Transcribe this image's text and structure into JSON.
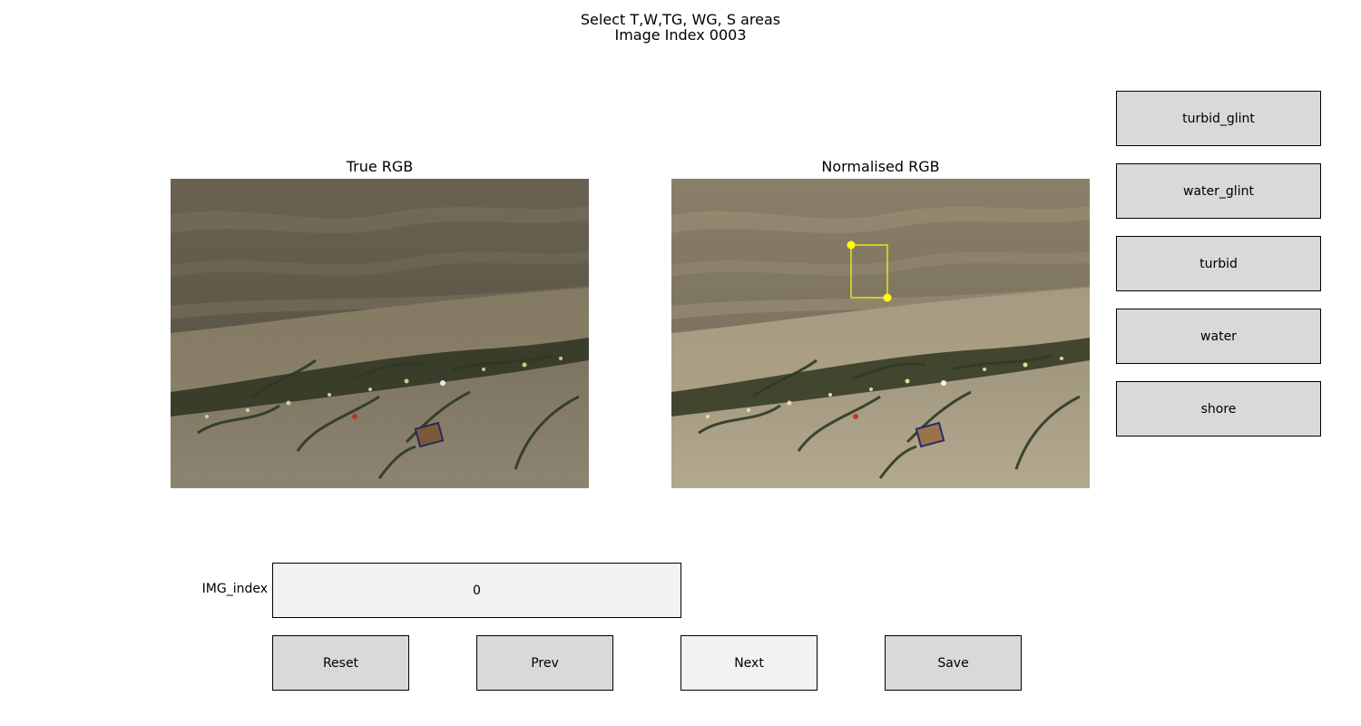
{
  "figure": {
    "title_line1": "Select T,W,TG, WG, S areas",
    "title_line2": "Image Index 0003"
  },
  "panels": {
    "left_title": "True RGB",
    "right_title": "Normalised RGB"
  },
  "selection": {
    "color": "#ffff00"
  },
  "class_buttons": [
    {
      "label": "turbid_glint"
    },
    {
      "label": "water_glint"
    },
    {
      "label": "turbid"
    },
    {
      "label": "water"
    },
    {
      "label": "shore"
    }
  ],
  "img_index": {
    "label": "IMG_index",
    "value": "0"
  },
  "nav_buttons": {
    "reset": "Reset",
    "prev": "Prev",
    "next": "Next",
    "save": "Save"
  },
  "colors": {
    "button_face": "#d9d9d9",
    "button_face_light": "#f2f2f2",
    "water_dark": "#5f5a4a",
    "sand": "#a89d85",
    "seaweed": "#2f3a20"
  }
}
